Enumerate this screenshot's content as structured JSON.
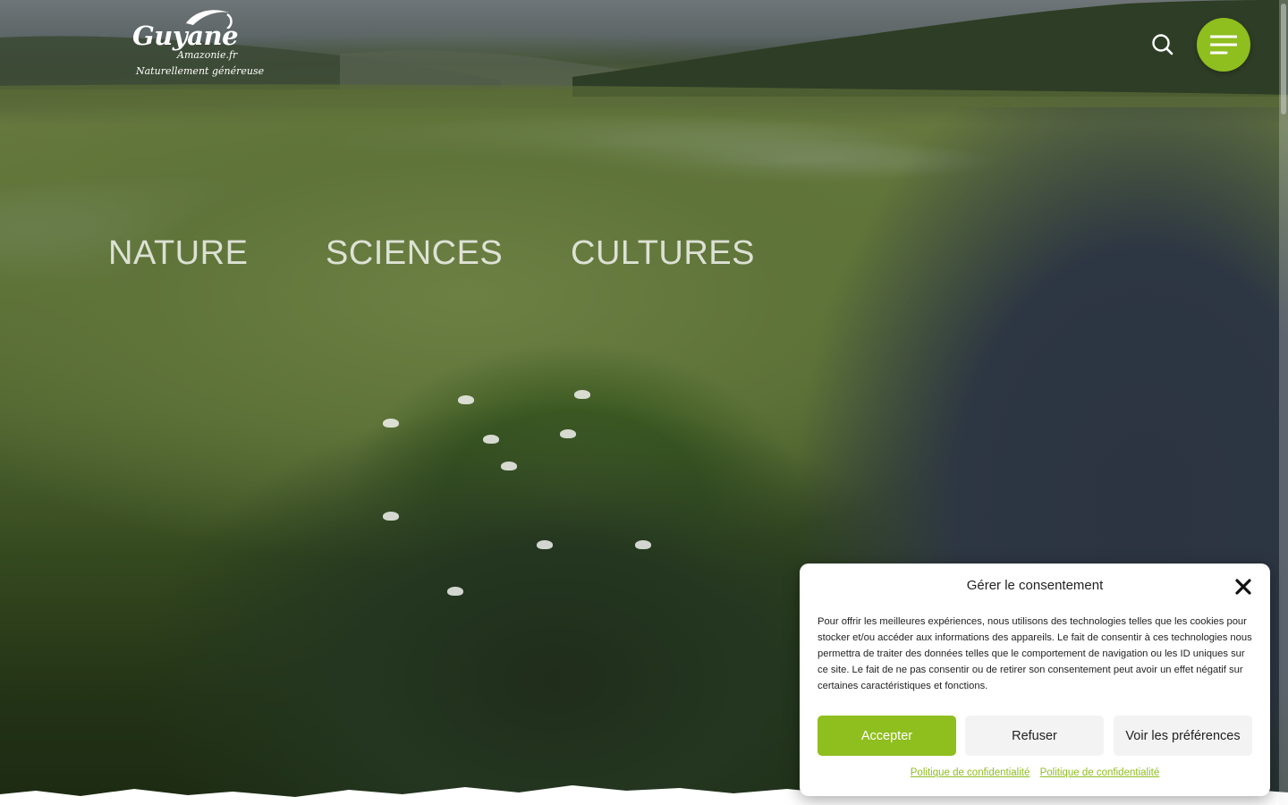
{
  "header": {
    "logo": {
      "main": "Guyane",
      "sub": "Amazonie.fr",
      "tagline": "Naturellement généreuse"
    },
    "search_icon": "search-icon",
    "menu_icon": "hamburger-menu-icon",
    "menu_color": "#8fbe1f"
  },
  "categories": [
    {
      "label": "NATURE"
    },
    {
      "label": "SCIENCES"
    },
    {
      "label": "CULTURES"
    }
  ],
  "consent": {
    "title": "Gérer le consentement",
    "text": "Pour offrir les meilleures expériences, nous utilisons des technologies telles que les cookies pour stocker et/ou accéder aux informations des appareils. Le fait de consentir à ces technologies nous permettra de traiter des données telles que le comportement de navigation ou les ID uniques sur ce site. Le fait de ne pas consentir ou de retirer son consentement peut avoir un effet négatif sur certaines caractéristiques et fonctions.",
    "accept_label": "Accepter",
    "refuse_label": "Refuser",
    "preferences_label": "Voir les préférences",
    "links": [
      {
        "label": "Politique de confidentialité"
      },
      {
        "label": "Politique de confidentialité"
      }
    ],
    "close_icon": "close-icon",
    "accent_color": "#8fbe1f"
  }
}
